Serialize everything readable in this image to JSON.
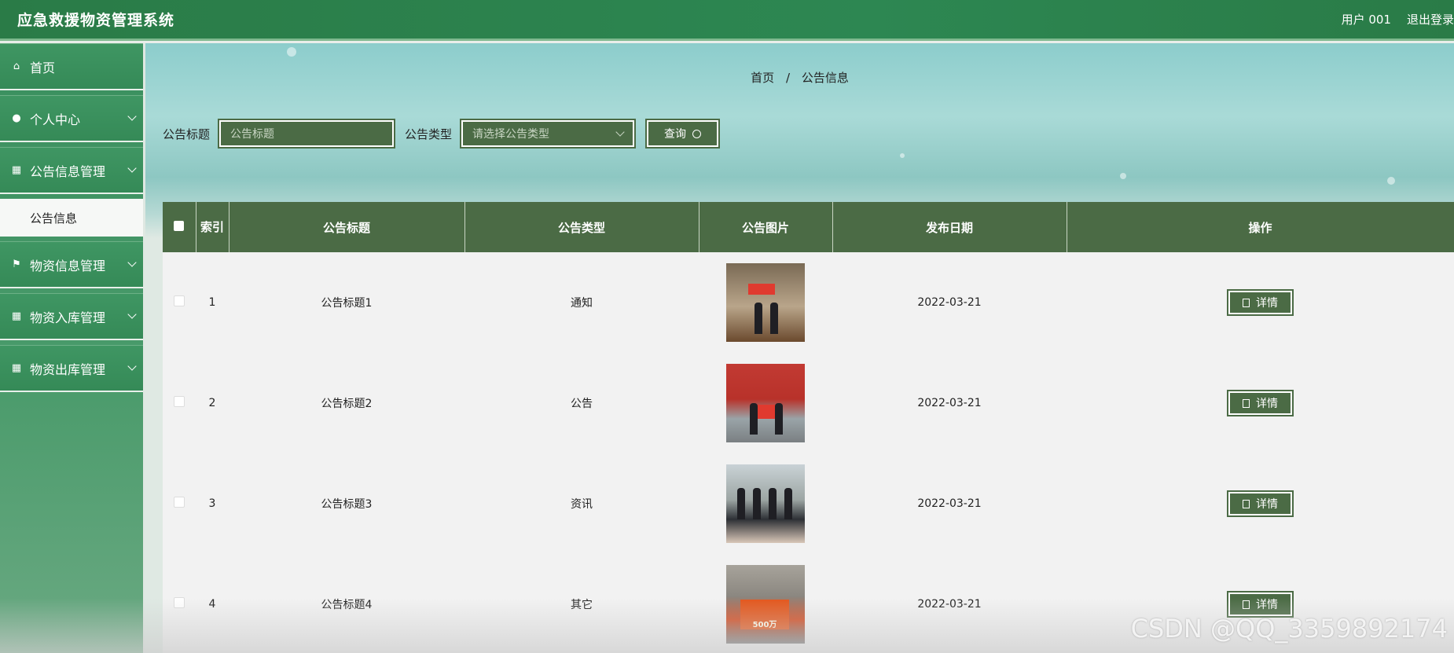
{
  "app": {
    "title": "应急救援物资管理系统",
    "user": "用户 001",
    "logout": "退出登录"
  },
  "sidebar": {
    "home": "首页",
    "personal": "个人中心",
    "notice_mgmt": "公告信息管理",
    "notice_sub": "公告信息",
    "material_info": "物资信息管理",
    "material_in": "物资入库管理",
    "material_out": "物资出库管理"
  },
  "breadcrumb": {
    "home": "首页",
    "sep": "/",
    "current": "公告信息"
  },
  "search": {
    "title_label": "公告标题",
    "title_placeholder": "公告标题",
    "type_label": "公告类型",
    "type_placeholder": "请选择公告类型",
    "query_button": "查询"
  },
  "table": {
    "headers": {
      "index": "索引",
      "title": "公告标题",
      "type": "公告类型",
      "image": "公告图片",
      "date": "发布日期",
      "action": "操作"
    },
    "rows": [
      {
        "index": "1",
        "title": "公告标题1",
        "type": "通知",
        "date": "2022-03-21",
        "action": "详情"
      },
      {
        "index": "2",
        "title": "公告标题2",
        "type": "公告",
        "date": "2022-03-21",
        "action": "详情"
      },
      {
        "index": "3",
        "title": "公告标题3",
        "type": "资讯",
        "date": "2022-03-21",
        "action": "详情"
      },
      {
        "index": "4",
        "title": "公告标题4",
        "type": "其它",
        "date": "2022-03-21",
        "action": "详情"
      }
    ]
  },
  "photo4_text": "500万",
  "watermark": "CSDN @QQ_3359892174",
  "colors": {
    "header": "#2a7b47",
    "table_header": "#4b6b45",
    "sidebar": "#3f9663"
  }
}
